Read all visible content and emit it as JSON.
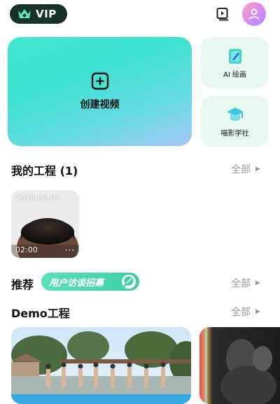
{
  "header": {
    "vip_label": "VIP",
    "vip_icon": "crown-icon",
    "library_icon": "video-library-icon",
    "avatar_icon": "user-icon"
  },
  "quick_actions": {
    "create": {
      "label": "创建视频",
      "icon": "plus-square-icon"
    },
    "ai_paint": {
      "label": "AI 绘画",
      "icon": "paint-book-icon"
    },
    "school": {
      "label": "喵影学社",
      "icon": "graduation-cap-icon"
    }
  },
  "my_projects": {
    "title": "我的工程 (1)",
    "see_all": "全部",
    "items": [
      {
        "date": "2024-06-01",
        "duration": "02:00",
        "more": "···"
      }
    ]
  },
  "recommend": {
    "title": "推荐",
    "banner_label": "用户访谈招募",
    "see_all": "全部"
  },
  "demo": {
    "title": "Demo工程",
    "see_all": "全部"
  },
  "colors": {
    "accent": "#43e6cd",
    "vip_bg": "#15322c",
    "side_card_bg": "#e9f7f1",
    "muted_text": "#9a9a9a"
  }
}
